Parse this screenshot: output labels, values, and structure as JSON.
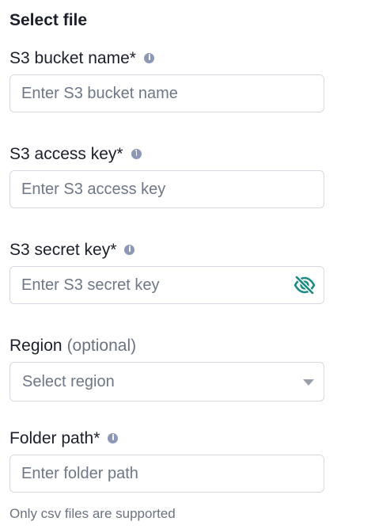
{
  "form": {
    "title": "Select file",
    "bucket": {
      "label": "S3 bucket name",
      "required_mark": "*",
      "placeholder": "Enter S3 bucket name",
      "value": "",
      "info_icon": "info-icon"
    },
    "access_key": {
      "label": "S3 access key",
      "required_mark": "*",
      "placeholder": "Enter S3 access key",
      "value": "",
      "info_icon": "info-icon"
    },
    "secret_key": {
      "label": "S3 secret key",
      "required_mark": "*",
      "placeholder": "Enter S3 secret key",
      "value": "",
      "info_icon": "info-icon",
      "visibility_icon": "eye-off-icon"
    },
    "region": {
      "label": "Region",
      "optional_text": "(optional)",
      "placeholder": "Select region",
      "selected_value": ""
    },
    "folder_path": {
      "label": "Folder path",
      "required_mark": "*",
      "placeholder": "Enter folder path",
      "value": "",
      "info_icon": "info-icon"
    },
    "hint": "Only csv files are supported"
  },
  "colors": {
    "accent": "#1e8a84",
    "info_icon": "#8c98b5",
    "border": "#d5d9e1",
    "placeholder": "#6e7787",
    "muted_text": "#6b7280"
  }
}
